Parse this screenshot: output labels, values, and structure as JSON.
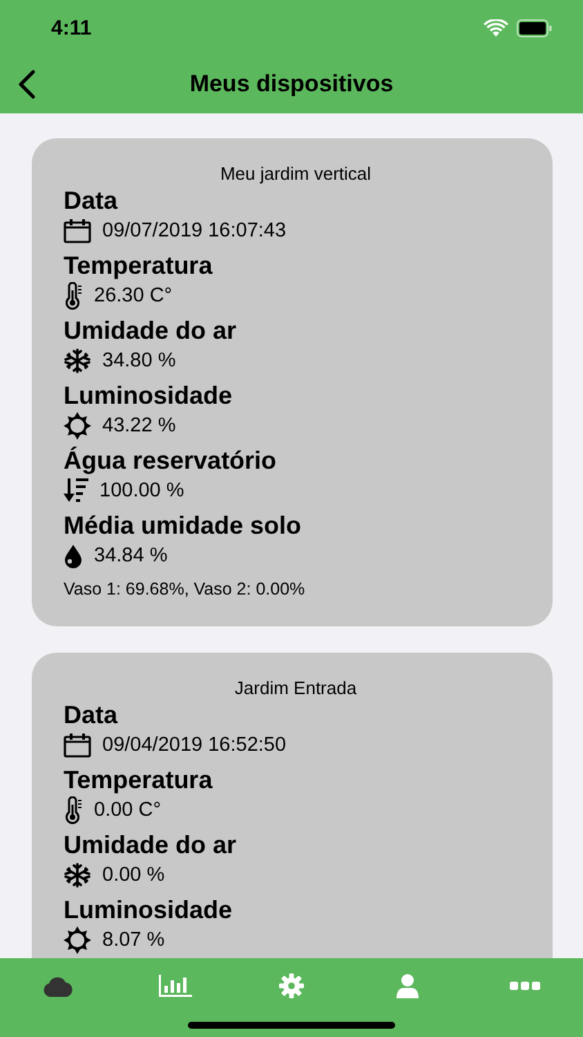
{
  "status_bar": {
    "time": "4:11"
  },
  "nav": {
    "title": "Meus dispositivos"
  },
  "devices": [
    {
      "name": "Meu jardim vertical",
      "metrics": [
        {
          "kind": "date",
          "label": "Data",
          "value": "09/07/2019 16:07:43"
        },
        {
          "kind": "temperature",
          "label": "Temperatura",
          "value": "26.30 C°"
        },
        {
          "kind": "humidity",
          "label": "Umidade do ar",
          "value": "34.80 %"
        },
        {
          "kind": "light",
          "label": "Luminosidade",
          "value": "43.22 %"
        },
        {
          "kind": "water",
          "label": "Água reservatório",
          "value": "100.00 %"
        },
        {
          "kind": "soil",
          "label": "Média umidade solo",
          "value": "34.84 %"
        }
      ],
      "note": "Vaso 1: 69.68%, Vaso 2: 0.00%"
    },
    {
      "name": "Jardim Entrada",
      "metrics": [
        {
          "kind": "date",
          "label": "Data",
          "value": "09/04/2019 16:52:50"
        },
        {
          "kind": "temperature",
          "label": "Temperatura",
          "value": "0.00 C°"
        },
        {
          "kind": "humidity",
          "label": "Umidade do ar",
          "value": "0.00 %"
        },
        {
          "kind": "light",
          "label": "Luminosidade",
          "value": "8.07 %"
        }
      ]
    }
  ],
  "tab_bar": [
    {
      "kind": "cloud",
      "selected": true
    },
    {
      "kind": "chart",
      "selected": false
    },
    {
      "kind": "settings",
      "selected": false
    },
    {
      "kind": "user",
      "selected": false
    },
    {
      "kind": "more",
      "selected": false
    }
  ]
}
